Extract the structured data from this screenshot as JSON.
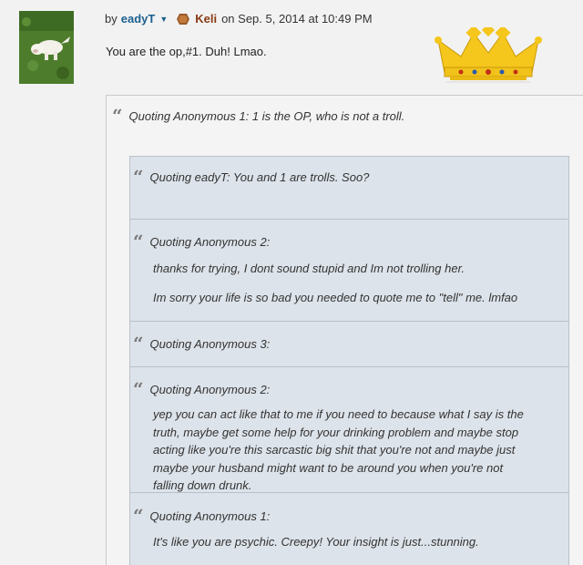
{
  "post": {
    "by_label": "by",
    "author": "eadyT",
    "recipient": "Keli",
    "date_text": "on Sep. 5, 2014 at 10:49 PM",
    "body": "You are the op,#1. Duh! Lmao."
  },
  "outer_quote": {
    "header": "Quoting Anonymous 1: 1 is the OP, who is not a troll."
  },
  "inner_quotes": [
    {
      "header": "Quoting eadyT: You and 1 are trolls. Soo?"
    },
    {
      "header": "Quoting Anonymous 2:",
      "lines": [
        "thanks for trying, I dont sound stupid and Im not trolling her.",
        "Im sorry your life is so bad you needed to quote me to \"tell\" me.  lmfao"
      ]
    },
    {
      "header": "Quoting Anonymous 3:"
    },
    {
      "header": "Quoting Anonymous 2:",
      "text": "yep you can act like that to me if you need to because what I say is the truth, maybe get some help for your drinking problem and maybe stop acting like you're this sarcastic big shit that you're not and maybe just maybe your husband might want to be around you when you're not falling down drunk."
    },
    {
      "header": "Quoting Anonymous 1:",
      "lines": [
        "It's like you are psychic. Creepy! Your insight is just...stunning."
      ]
    }
  ],
  "colors": {
    "author_link": "#1c5f8e",
    "recipient_link": "#8a3a15",
    "inner_quote_bg": "#dde3ea",
    "crown_gold": "#f2c619"
  },
  "icons": {
    "chevron": "chevron-down-icon",
    "badge": "hexagon-badge-icon",
    "quote": "quote-mark-icon",
    "crown": "crown-image"
  }
}
